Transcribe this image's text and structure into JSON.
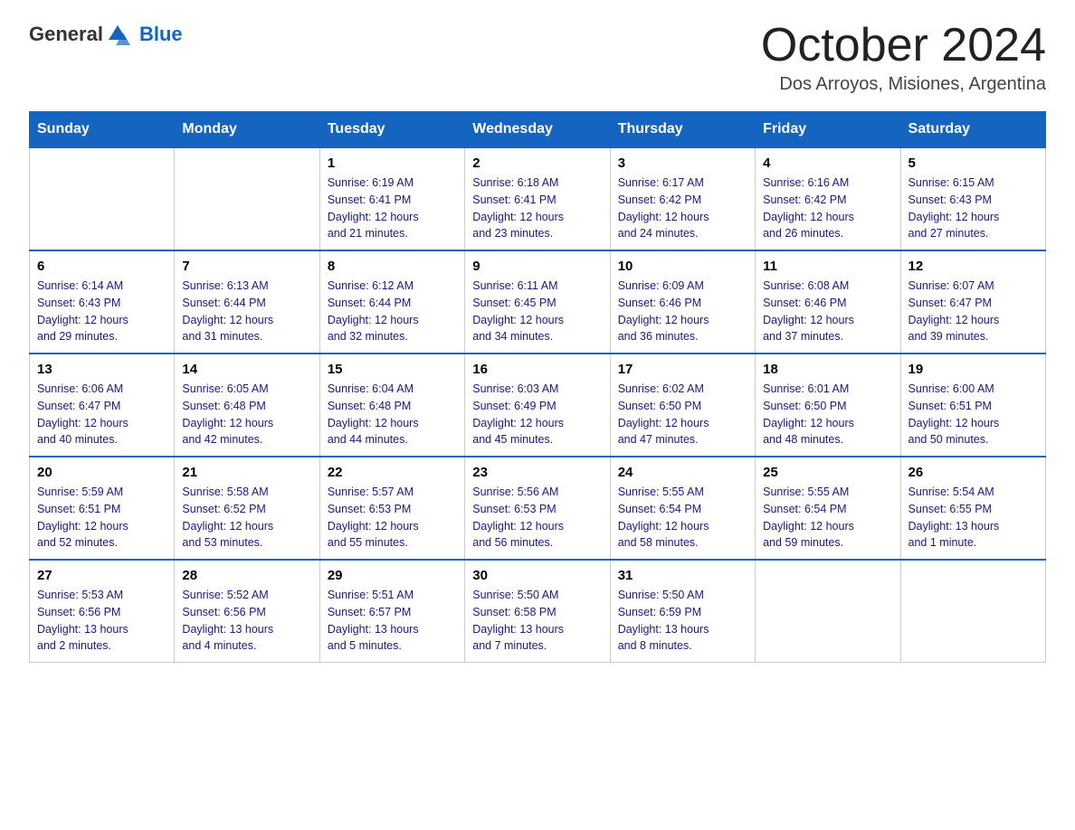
{
  "header": {
    "logo": {
      "general": "General",
      "blue": "Blue"
    },
    "title": "October 2024",
    "location": "Dos Arroyos, Misiones, Argentina"
  },
  "days_of_week": [
    "Sunday",
    "Monday",
    "Tuesday",
    "Wednesday",
    "Thursday",
    "Friday",
    "Saturday"
  ],
  "weeks": [
    [
      {
        "day": "",
        "info": ""
      },
      {
        "day": "",
        "info": ""
      },
      {
        "day": "1",
        "info": "Sunrise: 6:19 AM\nSunset: 6:41 PM\nDaylight: 12 hours\nand 21 minutes."
      },
      {
        "day": "2",
        "info": "Sunrise: 6:18 AM\nSunset: 6:41 PM\nDaylight: 12 hours\nand 23 minutes."
      },
      {
        "day": "3",
        "info": "Sunrise: 6:17 AM\nSunset: 6:42 PM\nDaylight: 12 hours\nand 24 minutes."
      },
      {
        "day": "4",
        "info": "Sunrise: 6:16 AM\nSunset: 6:42 PM\nDaylight: 12 hours\nand 26 minutes."
      },
      {
        "day": "5",
        "info": "Sunrise: 6:15 AM\nSunset: 6:43 PM\nDaylight: 12 hours\nand 27 minutes."
      }
    ],
    [
      {
        "day": "6",
        "info": "Sunrise: 6:14 AM\nSunset: 6:43 PM\nDaylight: 12 hours\nand 29 minutes."
      },
      {
        "day": "7",
        "info": "Sunrise: 6:13 AM\nSunset: 6:44 PM\nDaylight: 12 hours\nand 31 minutes."
      },
      {
        "day": "8",
        "info": "Sunrise: 6:12 AM\nSunset: 6:44 PM\nDaylight: 12 hours\nand 32 minutes."
      },
      {
        "day": "9",
        "info": "Sunrise: 6:11 AM\nSunset: 6:45 PM\nDaylight: 12 hours\nand 34 minutes."
      },
      {
        "day": "10",
        "info": "Sunrise: 6:09 AM\nSunset: 6:46 PM\nDaylight: 12 hours\nand 36 minutes."
      },
      {
        "day": "11",
        "info": "Sunrise: 6:08 AM\nSunset: 6:46 PM\nDaylight: 12 hours\nand 37 minutes."
      },
      {
        "day": "12",
        "info": "Sunrise: 6:07 AM\nSunset: 6:47 PM\nDaylight: 12 hours\nand 39 minutes."
      }
    ],
    [
      {
        "day": "13",
        "info": "Sunrise: 6:06 AM\nSunset: 6:47 PM\nDaylight: 12 hours\nand 40 minutes."
      },
      {
        "day": "14",
        "info": "Sunrise: 6:05 AM\nSunset: 6:48 PM\nDaylight: 12 hours\nand 42 minutes."
      },
      {
        "day": "15",
        "info": "Sunrise: 6:04 AM\nSunset: 6:48 PM\nDaylight: 12 hours\nand 44 minutes."
      },
      {
        "day": "16",
        "info": "Sunrise: 6:03 AM\nSunset: 6:49 PM\nDaylight: 12 hours\nand 45 minutes."
      },
      {
        "day": "17",
        "info": "Sunrise: 6:02 AM\nSunset: 6:50 PM\nDaylight: 12 hours\nand 47 minutes."
      },
      {
        "day": "18",
        "info": "Sunrise: 6:01 AM\nSunset: 6:50 PM\nDaylight: 12 hours\nand 48 minutes."
      },
      {
        "day": "19",
        "info": "Sunrise: 6:00 AM\nSunset: 6:51 PM\nDaylight: 12 hours\nand 50 minutes."
      }
    ],
    [
      {
        "day": "20",
        "info": "Sunrise: 5:59 AM\nSunset: 6:51 PM\nDaylight: 12 hours\nand 52 minutes."
      },
      {
        "day": "21",
        "info": "Sunrise: 5:58 AM\nSunset: 6:52 PM\nDaylight: 12 hours\nand 53 minutes."
      },
      {
        "day": "22",
        "info": "Sunrise: 5:57 AM\nSunset: 6:53 PM\nDaylight: 12 hours\nand 55 minutes."
      },
      {
        "day": "23",
        "info": "Sunrise: 5:56 AM\nSunset: 6:53 PM\nDaylight: 12 hours\nand 56 minutes."
      },
      {
        "day": "24",
        "info": "Sunrise: 5:55 AM\nSunset: 6:54 PM\nDaylight: 12 hours\nand 58 minutes."
      },
      {
        "day": "25",
        "info": "Sunrise: 5:55 AM\nSunset: 6:54 PM\nDaylight: 12 hours\nand 59 minutes."
      },
      {
        "day": "26",
        "info": "Sunrise: 5:54 AM\nSunset: 6:55 PM\nDaylight: 13 hours\nand 1 minute."
      }
    ],
    [
      {
        "day": "27",
        "info": "Sunrise: 5:53 AM\nSunset: 6:56 PM\nDaylight: 13 hours\nand 2 minutes."
      },
      {
        "day": "28",
        "info": "Sunrise: 5:52 AM\nSunset: 6:56 PM\nDaylight: 13 hours\nand 4 minutes."
      },
      {
        "day": "29",
        "info": "Sunrise: 5:51 AM\nSunset: 6:57 PM\nDaylight: 13 hours\nand 5 minutes."
      },
      {
        "day": "30",
        "info": "Sunrise: 5:50 AM\nSunset: 6:58 PM\nDaylight: 13 hours\nand 7 minutes."
      },
      {
        "day": "31",
        "info": "Sunrise: 5:50 AM\nSunset: 6:59 PM\nDaylight: 13 hours\nand 8 minutes."
      },
      {
        "day": "",
        "info": ""
      },
      {
        "day": "",
        "info": ""
      }
    ]
  ]
}
